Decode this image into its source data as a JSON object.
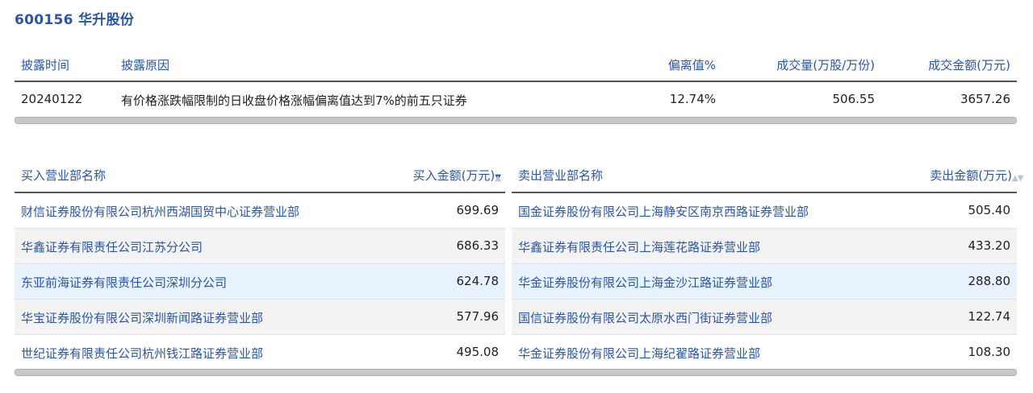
{
  "stock": {
    "title": "600156 华升股份"
  },
  "disclosure": {
    "headers": {
      "date": "披露时间",
      "reason": "披露原因",
      "deviation": "偏离值%",
      "volume": "成交量(万股/万份)",
      "amount": "成交金额(万元)"
    },
    "row": {
      "date": "20240122",
      "reason": "有价格涨跌幅限制的日收盘价格涨幅偏离值达到7%的前五只证券",
      "deviation": "12.74%",
      "volume": "506.55",
      "amount": "3657.26"
    }
  },
  "buy": {
    "headers": {
      "name": "买入营业部名称",
      "amount": "买入金额(万元)"
    },
    "rows": [
      {
        "name": "财信证券股份有限公司杭州西湖国贸中心证券营业部",
        "amount": "699.69"
      },
      {
        "name": "华鑫证券有限责任公司江苏分公司",
        "amount": "686.33"
      },
      {
        "name": "东亚前海证券有限责任公司深圳分公司",
        "amount": "624.78"
      },
      {
        "name": "华宝证券股份有限公司深圳新闻路证券营业部",
        "amount": "577.96"
      },
      {
        "name": "世纪证券有限责任公司杭州钱江路证券营业部",
        "amount": "495.08"
      }
    ]
  },
  "sell": {
    "headers": {
      "name": "卖出营业部名称",
      "amount": "卖出金额(万元)"
    },
    "rows": [
      {
        "name": "国金证券股份有限公司上海静安区南京西路证券营业部",
        "amount": "505.40"
      },
      {
        "name": "华鑫证券有限责任公司上海莲花路证券营业部",
        "amount": "433.20"
      },
      {
        "name": "华金证券股份有限公司上海金沙江路证券营业部",
        "amount": "288.80"
      },
      {
        "name": "国信证券股份有限公司太原水西门街证券营业部",
        "amount": "122.74"
      },
      {
        "name": "华金证券股份有限公司上海纪翟路证券营业部",
        "amount": "108.30"
      }
    ]
  },
  "icons": {
    "sort": "sort-up-down-icon"
  },
  "colors": {
    "link": "#2a56a6",
    "row_alt": "#f3f3f3",
    "row_highlight": "#e8f2fc"
  }
}
